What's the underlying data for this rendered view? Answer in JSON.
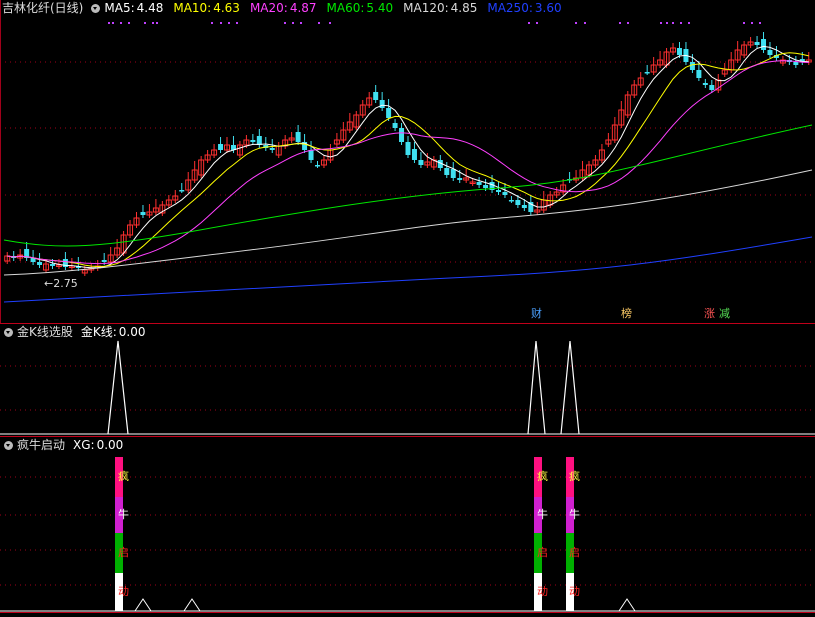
{
  "main": {
    "title": "吉林化纤(日线)",
    "ma": [
      {
        "label": "MA5:",
        "value": "4.48",
        "color": "#ffffff"
      },
      {
        "label": "MA10:",
        "value": "4.63",
        "color": "#ffff00"
      },
      {
        "label": "MA20:",
        "value": "4.87",
        "color": "#ff40ff"
      },
      {
        "label": "MA60:",
        "value": "5.40",
        "color": "#00e600"
      },
      {
        "label": "MA120:",
        "value": "4.85",
        "color": "#d8d8d8"
      },
      {
        "label": "MA250:",
        "value": "3.60",
        "color": "#2040ff"
      }
    ],
    "low_label": "2.75",
    "tags": [
      {
        "text": "财",
        "color": "#4aa0ff"
      },
      {
        "text": "榜",
        "color": "#ffcc66"
      },
      {
        "text": "涨",
        "color": "#ff5555"
      },
      {
        "text": "减",
        "color": "#55dd55"
      }
    ]
  },
  "panel2": {
    "title": "金K线选股",
    "indicator": "金K线:",
    "value": "0.00"
  },
  "panel3": {
    "title": "疯牛启动",
    "indicator": "XG:",
    "value": "0.00",
    "signal_chars": [
      "疯",
      "牛",
      "启",
      "动"
    ]
  },
  "colors": {
    "up": "#ff3030",
    "down": "#40e0f0",
    "grid": "#a0001a",
    "separator": "#c0001a",
    "signal_top": "#ff1080",
    "signal_mid": "#d020d0",
    "signal_green": "#00b000",
    "signal_white": "#ffffff"
  }
}
